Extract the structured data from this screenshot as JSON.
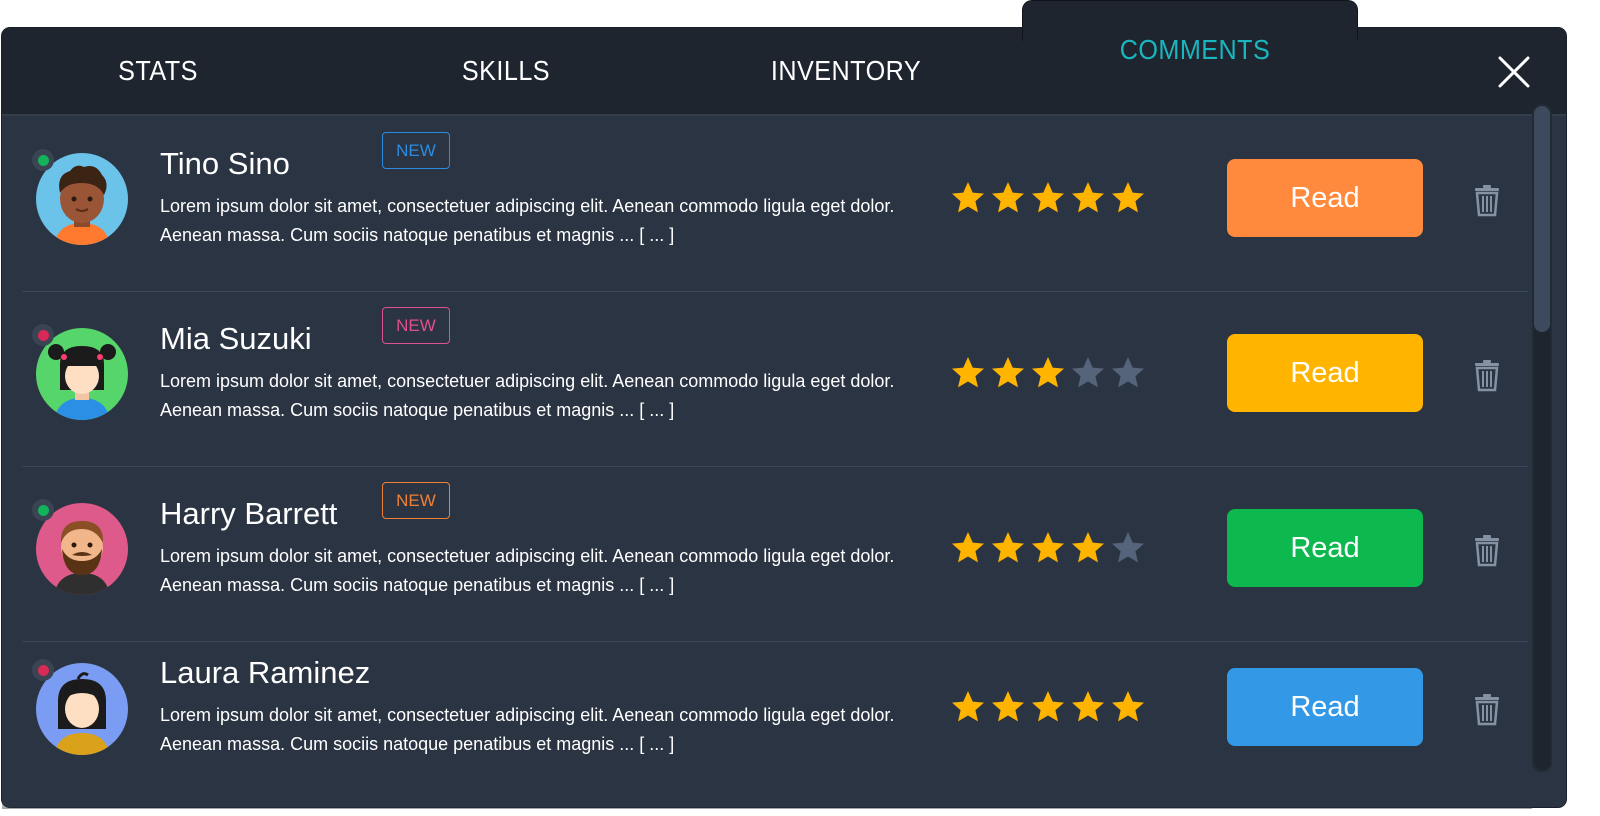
{
  "tabs": [
    {
      "label": "STATS",
      "active": false
    },
    {
      "label": "SKILLS",
      "active": false
    },
    {
      "label": "INVENTORY",
      "active": false
    },
    {
      "label": "COMMENTS",
      "active": true
    }
  ],
  "close_icon": "close-icon",
  "comments": [
    {
      "name": "Tino Sino",
      "online": true,
      "status_color": "#12b35a",
      "badge": "NEW",
      "badge_color": "#2d8cdf",
      "text": "Lorem ipsum dolor sit amet, consectetuer adipiscing elit. Aenean commodo ligula eget dolor. Aenean massa. Cum sociis natoque penatibus et magnis ... [ ... ]",
      "rating": 5,
      "read_label": "Read",
      "button_color": "#ff8a3d",
      "avatar_bg": "#6cc3ea",
      "avatar_icon": "avatar-icon"
    },
    {
      "name": "Mia Suzuki",
      "online": false,
      "status_color": "#d82a56",
      "badge": "NEW",
      "badge_color": "#e0508c",
      "text": "Lorem ipsum dolor sit amet, consectetuer adipiscing elit. Aenean commodo ligula eget dolor. Aenean massa. Cum sociis natoque penatibus et magnis ... [ ... ]",
      "rating": 3,
      "read_label": "Read",
      "button_color": "#ffb400",
      "avatar_bg": "#55d56a",
      "avatar_icon": "avatar-icon"
    },
    {
      "name": "Harry Barrett",
      "online": true,
      "status_color": "#12b35a",
      "badge": "NEW",
      "badge_color": "#f08035",
      "text": "Lorem ipsum dolor sit amet, consectetuer adipiscing elit. Aenean commodo ligula eget dolor. Aenean massa. Cum sociis natoque penatibus et magnis ... [ ... ]",
      "rating": 4,
      "read_label": "Read",
      "button_color": "#0db84e",
      "avatar_bg": "#de5a8a",
      "avatar_icon": "avatar-icon"
    },
    {
      "name": "Laura Raminez",
      "online": false,
      "status_color": "#d82a56",
      "badge": "",
      "badge_color": "",
      "text": "Lorem ipsum dolor sit amet, consectetuer adipiscing elit. Aenean commodo ligula eget dolor. Aenean massa. Cum sociis natoque penatibus et magnis ... [ ... ]",
      "rating": 5,
      "read_label": "Read",
      "button_color": "#3399e6",
      "avatar_bg": "#7a9cf2",
      "avatar_icon": "avatar-icon"
    }
  ],
  "colors": {
    "panel": "#2b3442",
    "tabbar": "#1e252f",
    "active_tab": "#19b6bf",
    "star_on": "#ffb400",
    "star_off": "#55647a",
    "trash": "#8592a4"
  }
}
